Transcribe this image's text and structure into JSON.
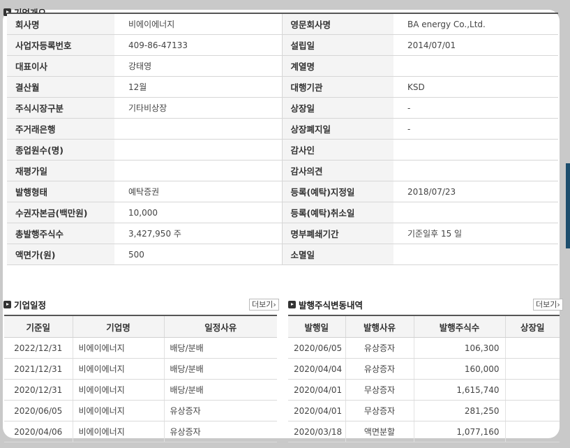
{
  "overview": {
    "title": "기업개요",
    "rows": [
      {
        "l1": "회사명",
        "v1": "비에이에너지",
        "l2": "영문회사명",
        "v2": "BA energy Co.,Ltd."
      },
      {
        "l1": "사업자등록번호",
        "v1": "409-86-47133",
        "l2": "설립일",
        "v2": "2014/07/01"
      },
      {
        "l1": "대표이사",
        "v1": "강태영",
        "l2": "계열명",
        "v2": ""
      },
      {
        "l1": "결산월",
        "v1": "12월",
        "l2": "대행기관",
        "v2": "KSD"
      },
      {
        "l1": "주식시장구분",
        "v1": "기타비상장",
        "l2": "상장일",
        "v2": "-"
      },
      {
        "l1": "주거래은행",
        "v1": "",
        "l2": "상장폐지일",
        "v2": "-"
      },
      {
        "l1": "종업원수(명)",
        "v1": "",
        "l2": "감사인",
        "v2": ""
      },
      {
        "l1": "재평가일",
        "v1": "",
        "l2": "감사의견",
        "v2": ""
      },
      {
        "l1": "발행형태",
        "v1": "예탁증권",
        "l2": "등록(예탁)지정일",
        "v2": "2018/07/23"
      },
      {
        "l1": "수권자본금(백만원)",
        "v1": "10,000",
        "l2": "등록(예탁)취소일",
        "v2": ""
      },
      {
        "l1": "총발행주식수",
        "v1": "3,427,950 주",
        "l2": "명부폐쇄기간",
        "v2": "기준일후 15 일"
      },
      {
        "l1": "액면가(원)",
        "v1": "500",
        "l2": "소멸일",
        "v2": ""
      }
    ]
  },
  "schedule": {
    "title": "기업일정",
    "more": "더보기",
    "headers": [
      "기준일",
      "기업명",
      "일정사유"
    ],
    "rows": [
      [
        "2022/12/31",
        "비에이에너지",
        "배당/분배"
      ],
      [
        "2021/12/31",
        "비에이에너지",
        "배당/분배"
      ],
      [
        "2020/12/31",
        "비에이에너지",
        "배당/분배"
      ],
      [
        "2020/06/05",
        "비에이에너지",
        "유상증자"
      ],
      [
        "2020/04/06",
        "비에이에너지",
        "유상증자"
      ]
    ]
  },
  "issuance": {
    "title": "발행주식변동내역",
    "more": "더보기",
    "headers": [
      "발행일",
      "발행사유",
      "발행주식수",
      "상장일"
    ],
    "rows": [
      [
        "2020/06/05",
        "유상증자",
        "106,300",
        ""
      ],
      [
        "2020/04/04",
        "유상증자",
        "160,000",
        ""
      ],
      [
        "2020/04/01",
        "무상증자",
        "1,615,740",
        ""
      ],
      [
        "2020/04/01",
        "무상증자",
        "281,250",
        ""
      ],
      [
        "2020/03/18",
        "액면분할",
        "1,077,160",
        ""
      ]
    ]
  }
}
